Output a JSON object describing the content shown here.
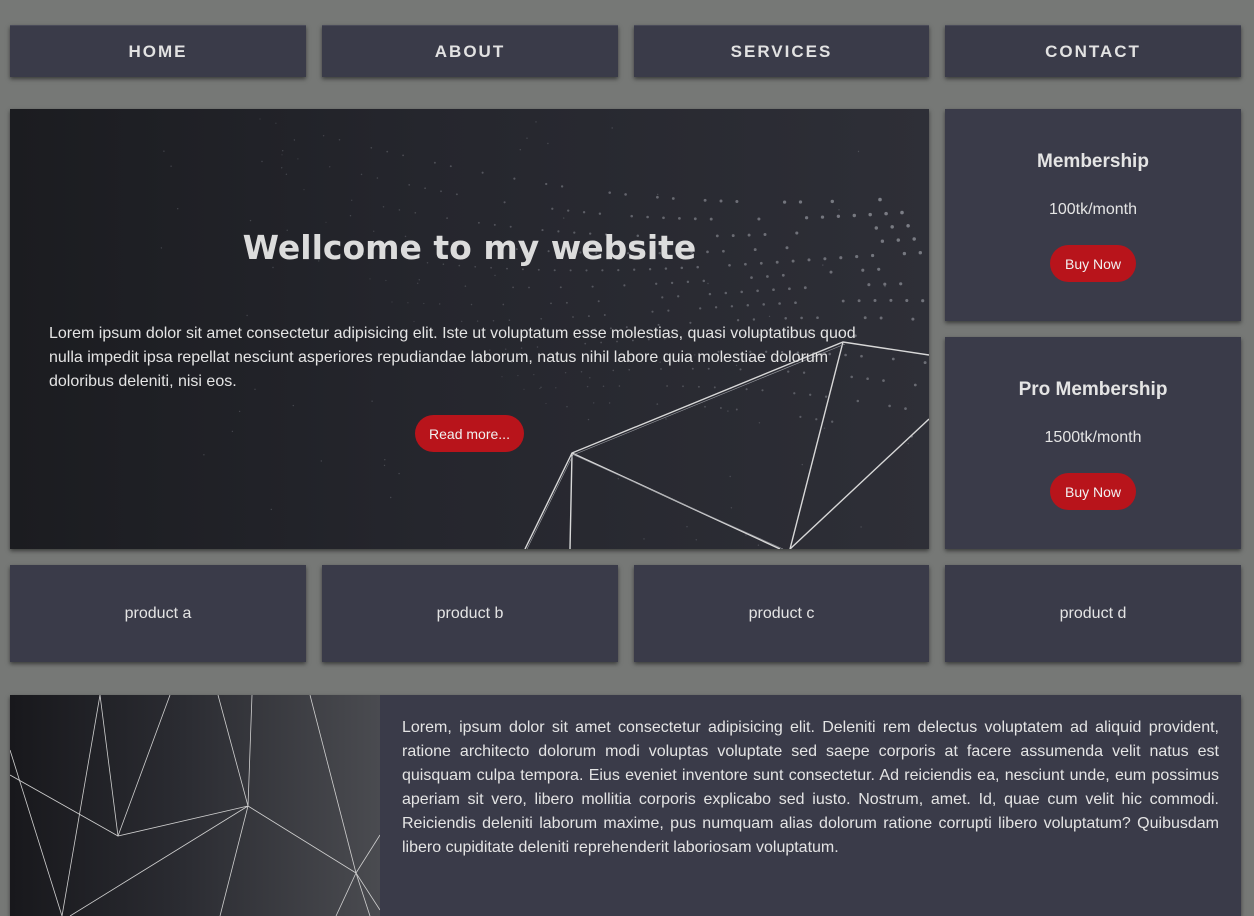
{
  "nav": {
    "items": [
      {
        "label": "HOME"
      },
      {
        "label": "ABOUT"
      },
      {
        "label": "SERVICES"
      },
      {
        "label": "CONTACT"
      }
    ]
  },
  "hero": {
    "title": "Wellcome to my website",
    "text": "Lorem ipsum dolor sit amet consectetur adipisicing elit. Iste ut voluptatum esse molestias, quasi voluptatibus quod nulla impedit ipsa repellat nesciunt asperiores repudiandae laborum, natus nihil labore quia molestiae dolorum doloribus deleniti, nisi eos.",
    "button_label": "Read more..."
  },
  "plans": [
    {
      "title": "Membership",
      "price": "100tk/month",
      "button_label": "Buy Now"
    },
    {
      "title": "Pro Membership",
      "price": "1500tk/month",
      "button_label": "Buy Now"
    }
  ],
  "products": [
    {
      "label": "product a"
    },
    {
      "label": "product b"
    },
    {
      "label": "product c"
    },
    {
      "label": "product d"
    }
  ],
  "about": {
    "text": "Lorem, ipsum dolor sit amet consectetur adipisicing elit. Deleniti rem delectus voluptatem ad aliquid provident, ratione architecto dolorum modi voluptas voluptate sed saepe corporis at facere assumenda velit natus est quisquam culpa tempora. Eius eveniet inventore sunt consectetur. Ad reiciendis ea, nesciunt unde, eum possimus aperiam sit vero, libero mollitia corporis explicabo sed iusto. Nostrum, amet. Id, quae cum velit hic commodi. Reiciendis deleniti laborum maxime, pus numquam alias dolorum ratione corrupti libero voluptatum? Quibusdam libero cupiditate deleniti reprehenderit laboriosam voluptatum."
  },
  "colors": {
    "page_background": "#767876",
    "panel": "#3a3b49",
    "accent_red": "#b8141b",
    "text": "#e4e4e4"
  }
}
